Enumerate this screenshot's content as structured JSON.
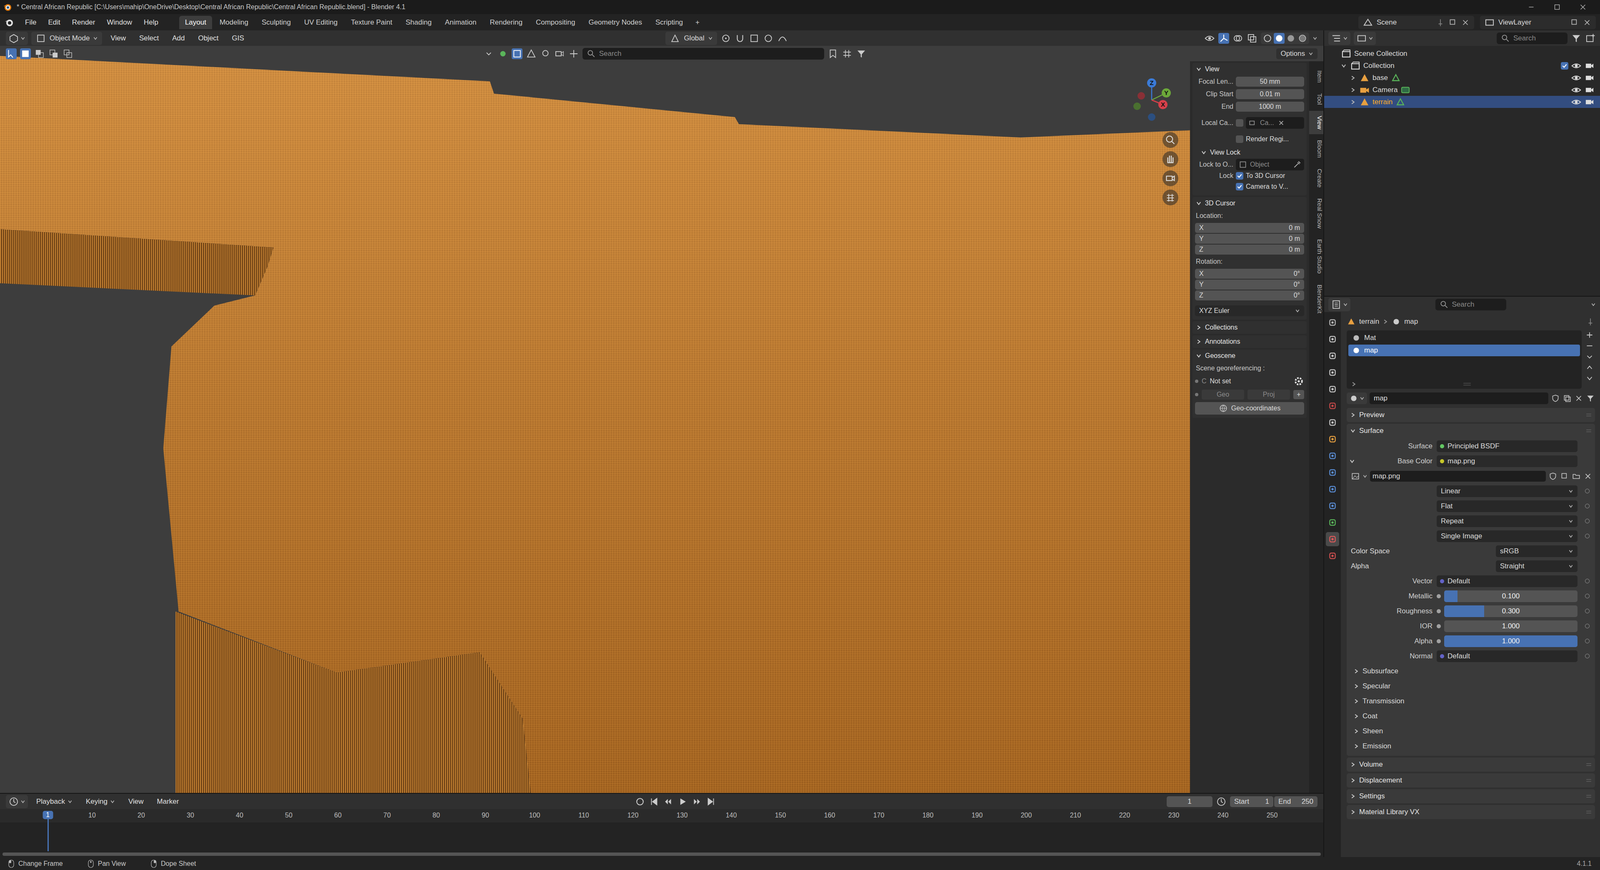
{
  "window": {
    "title": "* Central African Republic [C:\\Users\\mahip\\OneDrive\\Desktop\\Central African Republic\\Central African Republic.blend] - Blender 4.1"
  },
  "menus": [
    "File",
    "Edit",
    "Render",
    "Window",
    "Help"
  ],
  "workspaces": [
    {
      "label": "Layout",
      "selected": true
    },
    {
      "label": "Modeling",
      "selected": false
    },
    {
      "label": "Sculpting",
      "selected": false
    },
    {
      "label": "UV Editing",
      "selected": false
    },
    {
      "label": "Texture Paint",
      "selected": false
    },
    {
      "label": "Shading",
      "selected": false
    },
    {
      "label": "Animation",
      "selected": false
    },
    {
      "label": "Rendering",
      "selected": false
    },
    {
      "label": "Compositing",
      "selected": false
    },
    {
      "label": "Geometry Nodes",
      "selected": false
    },
    {
      "label": "Scripting",
      "selected": false
    }
  ],
  "add_workspace": "+",
  "scene": "Scene",
  "view_layer": "ViewLayer",
  "viewport": {
    "mode": "Object Mode",
    "menus": [
      "View",
      "Select",
      "Add",
      "Object",
      "GIS"
    ],
    "orientation": "Global",
    "search_placeholder": "Search",
    "options": "Options",
    "gizmo_axes": [
      "X",
      "Y",
      "Z"
    ]
  },
  "sidebar": {
    "tabs": [
      {
        "label": "Item",
        "selected": false
      },
      {
        "label": "Tool",
        "selected": false
      },
      {
        "label": "View",
        "selected": true
      },
      {
        "label": "Bloom",
        "selected": false
      },
      {
        "label": "Create",
        "selected": false
      },
      {
        "label": "Real Snow",
        "selected": false
      },
      {
        "label": "Earth Studio",
        "selected": false
      },
      {
        "label": "BlenderKit",
        "selected": false
      }
    ],
    "view": {
      "title": "View",
      "expanded": true,
      "fields": [
        {
          "label": "Focal Len...",
          "value": "50 mm"
        },
        {
          "label": "Clip Start",
          "value": "0.01 m"
        },
        {
          "label": "End",
          "value": "1000 m"
        }
      ],
      "local_camera": {
        "label": "Local Ca...",
        "checked": false,
        "value": "Ca..."
      },
      "render_region": {
        "label": "Render Regi...",
        "checked": false
      }
    },
    "view_lock": {
      "title": "View Lock",
      "expanded": true,
      "lock_object": {
        "label": "Lock to O...",
        "placeholder": "Object"
      },
      "lock_label": "Lock",
      "options": [
        {
          "label": "To 3D Cursor",
          "checked": true
        },
        {
          "label": "Camera to V...",
          "checked": true
        }
      ]
    },
    "cursor": {
      "title": "3D Cursor",
      "expanded": true,
      "location_label": "Location:",
      "location": [
        {
          "axis": "X",
          "value": "0 m"
        },
        {
          "axis": "Y",
          "value": "0 m"
        },
        {
          "axis": "Z",
          "value": "0 m"
        }
      ],
      "rotation_label": "Rotation:",
      "rotation": [
        {
          "axis": "X",
          "value": "0°"
        },
        {
          "axis": "Y",
          "value": "0°"
        },
        {
          "axis": "Z",
          "value": "0°"
        }
      ],
      "mode": "XYZ Euler"
    },
    "collapsed": [
      {
        "title": "Collections",
        "expanded": false
      },
      {
        "title": "Annotations",
        "expanded": false
      }
    ],
    "geoscene": {
      "title": "Geoscene",
      "expanded": true,
      "label": "Scene georeferencing :",
      "crs_prefix": "C",
      "crs": "Not set",
      "geo": "Geo",
      "proj": "Proj",
      "add": "+",
      "button": "Geo-coordinates"
    }
  },
  "outliner": {
    "search_placeholder": "Search",
    "items": [
      {
        "label": "Scene Collection",
        "kind": "scene-collection",
        "expandable": false,
        "expanded": false,
        "selected": false,
        "visible": true
      },
      {
        "label": "Collection",
        "kind": "collection",
        "expandable": true,
        "expanded": true,
        "selected": false,
        "visible": true
      },
      {
        "label": "base",
        "kind": "mesh",
        "expandable": true,
        "expanded": false,
        "selected": false,
        "visible": true
      },
      {
        "label": "Camera",
        "kind": "camera",
        "expandable": true,
        "expanded": false,
        "selected": false,
        "visible": true
      },
      {
        "label": "terrain",
        "kind": "mesh",
        "expandable": true,
        "expanded": false,
        "selected": true,
        "visible": true
      }
    ]
  },
  "properties": {
    "search_placeholder": "Search",
    "editor_tabs": [
      {
        "selected": false,
        "color": "#b8b8b8"
      },
      {
        "selected": false,
        "color": "#c8c8c8"
      },
      {
        "selected": false,
        "color": "#c8c8c8"
      },
      {
        "selected": false,
        "color": "#c8c8c8"
      },
      {
        "selected": false,
        "color": "#c8c8c8"
      },
      {
        "selected": false,
        "color": "#c84a4a"
      },
      {
        "selected": false,
        "color": "#c8c8c8"
      },
      {
        "selected": false,
        "color": "#e8a040"
      },
      {
        "selected": false,
        "color": "#5b8fd8"
      },
      {
        "selected": false,
        "color": "#5b8fd8"
      },
      {
        "selected": false,
        "color": "#5b8fd8"
      },
      {
        "selected": false,
        "color": "#5b8fd8"
      },
      {
        "selected": false,
        "color": "#5ab55a"
      },
      {
        "selected": true,
        "color": "#e05a5a"
      },
      {
        "selected": false,
        "color": "#d05050"
      }
    ],
    "breadcrumb": [
      "terrain",
      "map"
    ],
    "slots": [
      {
        "label": "Mat",
        "selected": false
      },
      {
        "label": "map",
        "selected": true
      }
    ],
    "material": "map",
    "sections_top": [
      {
        "title": "Preview",
        "expanded": false
      },
      {
        "title": "Surface",
        "expanded": true
      }
    ],
    "surface": {
      "label": "Surface",
      "shader": "Principled BSDF"
    },
    "base_color": {
      "label": "Base Color",
      "value": "map.png",
      "expanded": true
    },
    "image": {
      "name": "map.png",
      "options": [
        "Linear",
        "Flat",
        "Repeat",
        "Single Image"
      ],
      "color_space": {
        "label": "Color Space",
        "value": "sRGB"
      },
      "alpha": {
        "label": "Alpha",
        "value": "Straight"
      }
    },
    "inputs": [
      {
        "label": "Vector",
        "kind": "link",
        "value": "Default",
        "level": 0
      },
      {
        "label": "Metallic",
        "kind": "slider",
        "value": "0.100",
        "level": 0.1
      },
      {
        "label": "Roughness",
        "kind": "slider",
        "value": "0.300",
        "level": 0.3
      },
      {
        "label": "IOR",
        "kind": "slider",
        "value": "1.000",
        "level": 0
      },
      {
        "label": "Alpha",
        "kind": "slider",
        "value": "1.000",
        "level": 1
      },
      {
        "label": "Normal",
        "kind": "link",
        "value": "Default",
        "level": 0
      }
    ],
    "subpanels": [
      {
        "title": "Subsurface",
        "expanded": false
      },
      {
        "title": "Specular",
        "expanded": false
      },
      {
        "title": "Transmission",
        "expanded": false
      },
      {
        "title": "Coat",
        "expanded": false
      },
      {
        "title": "Sheen",
        "expanded": false
      },
      {
        "title": "Emission",
        "expanded": false
      }
    ],
    "panels": [
      {
        "title": "Volume",
        "expanded": false
      },
      {
        "title": "Displacement",
        "expanded": false
      },
      {
        "title": "Settings",
        "expanded": false
      },
      {
        "title": "Material Library VX",
        "expanded": false
      }
    ]
  },
  "timeline": {
    "menus": [
      "Playback",
      "Keying",
      "View",
      "Marker"
    ],
    "frame": "1",
    "start_label": "Start",
    "start": "1",
    "end_label": "End",
    "end": "250",
    "current": "1",
    "ticks": [
      "10",
      "20",
      "30",
      "40",
      "50",
      "60",
      "70",
      "80",
      "90",
      "100",
      "110",
      "120",
      "130",
      "140",
      "150",
      "160",
      "170",
      "180",
      "190",
      "200",
      "210",
      "220",
      "230",
      "240",
      "250"
    ]
  },
  "status_bar": {
    "items": [
      "Change Frame",
      "Pan View",
      "Dope Sheet"
    ],
    "version": "4.1.1"
  }
}
